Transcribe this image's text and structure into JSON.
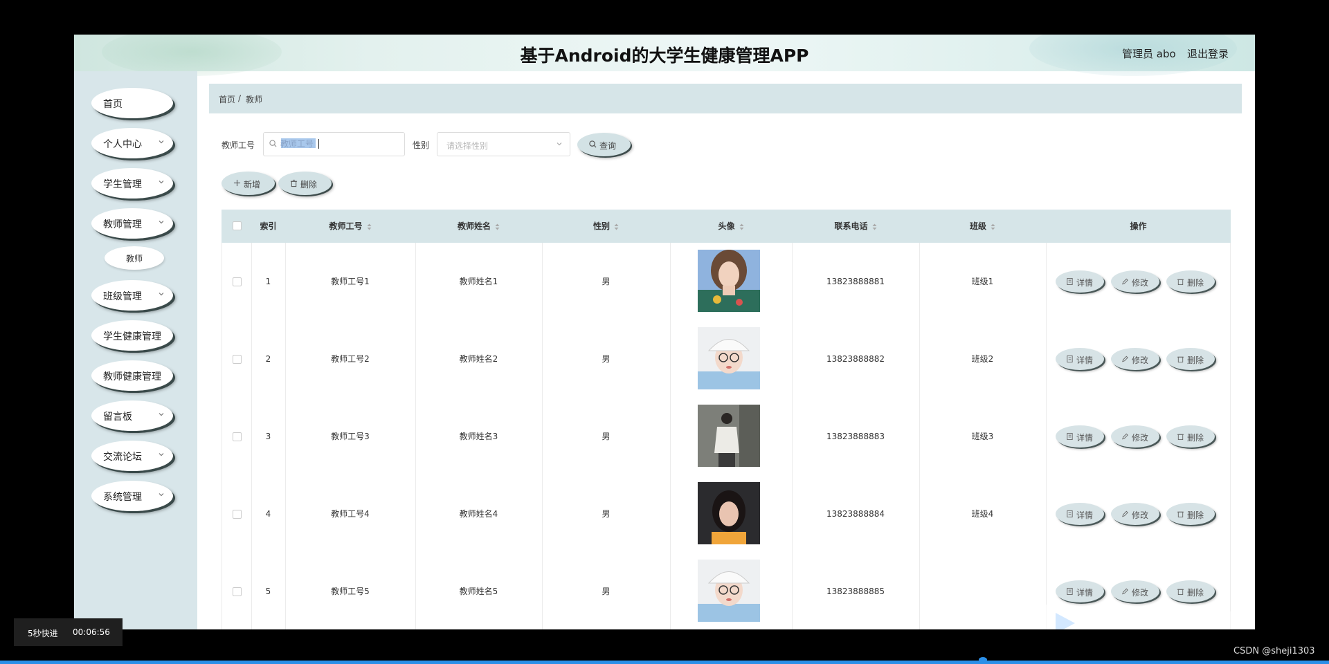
{
  "header": {
    "title": "基于Android的大学生健康管理APP",
    "admin": "管理员 abo",
    "logout": "退出登录"
  },
  "sidebar": {
    "items": [
      {
        "label": "首页",
        "has_children": false
      },
      {
        "label": "个人中心",
        "has_children": true
      },
      {
        "label": "学生管理",
        "has_children": true
      },
      {
        "label": "教师管理",
        "has_children": true
      },
      {
        "label": "班级管理",
        "has_children": true
      },
      {
        "label": "学生健康管理",
        "has_children": false
      },
      {
        "label": "教师健康管理",
        "has_children": false
      },
      {
        "label": "留言板",
        "has_children": true
      },
      {
        "label": "交流论坛",
        "has_children": true
      },
      {
        "label": "系统管理",
        "has_children": true
      }
    ],
    "sub_item": "教师"
  },
  "breadcrumb": {
    "home": "首页",
    "sep": "/",
    "current": "教师"
  },
  "filters": {
    "id_label": "教师工号",
    "id_value": "",
    "id_placeholder": "教师工号",
    "gender_label": "性别",
    "gender_placeholder": "请选择性别",
    "query_button": "查询"
  },
  "actions": {
    "add": "新增",
    "delete": "删除"
  },
  "table": {
    "columns": [
      "索引",
      "教师工号",
      "教师姓名",
      "性别",
      "头像",
      "联系电话",
      "班级",
      "操作"
    ],
    "row_actions": [
      "详情",
      "修改",
      "删除"
    ],
    "rows": [
      {
        "index": "1",
        "id": "教师工号1",
        "name": "教师姓名1",
        "gender": "男",
        "phone": "13823888881",
        "class": "班级1",
        "avatar": "avatar-girl-floral"
      },
      {
        "index": "2",
        "id": "教师工号2",
        "name": "教师姓名2",
        "gender": "男",
        "phone": "13823888882",
        "class": "班级2",
        "avatar": "avatar-girl-cap-glasses"
      },
      {
        "index": "3",
        "id": "教师工号3",
        "name": "教师姓名3",
        "gender": "男",
        "phone": "13823888883",
        "class": "班级3",
        "avatar": "avatar-person-street"
      },
      {
        "index": "4",
        "id": "教师工号4",
        "name": "教师姓名4",
        "gender": "男",
        "phone": "13823888884",
        "class": "班级4",
        "avatar": "avatar-girl-dark"
      },
      {
        "index": "5",
        "id": "教师工号5",
        "name": "教师姓名5",
        "gender": "男",
        "phone": "13823888885",
        "class": "",
        "avatar": "avatar-girl-cap-glasses"
      }
    ]
  },
  "player": {
    "speed_label": "5秒快进",
    "time": "00:06:56"
  },
  "watermark": "CSDN @sheji1303",
  "colors": {
    "accent_bg": "#d6e5e8",
    "sidebar_bg": "#d8e6ea",
    "progress": "#2b8fe8"
  }
}
